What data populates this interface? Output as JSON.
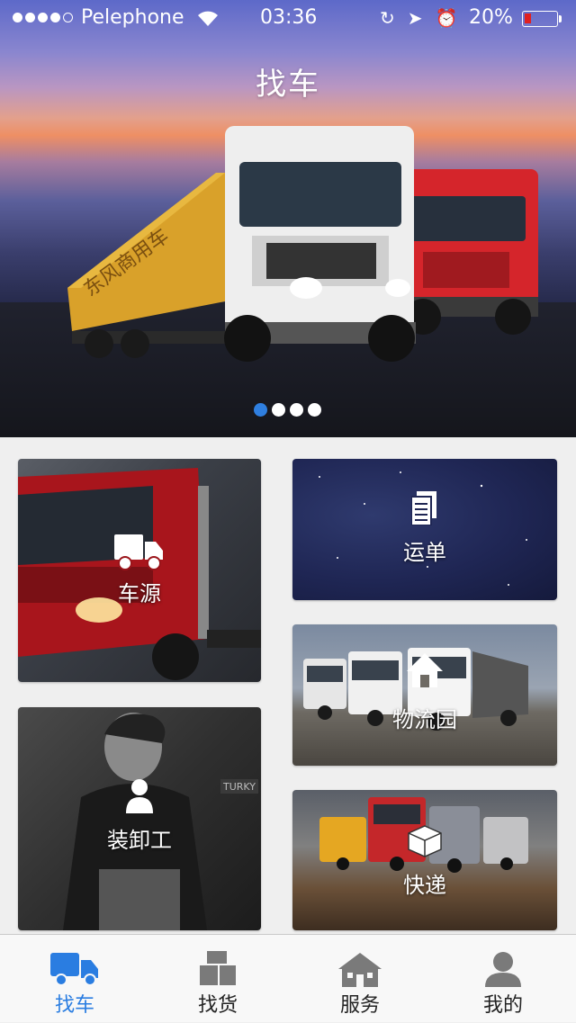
{
  "status_bar": {
    "carrier": "Pelephone",
    "time": "03:36",
    "battery_percent": "20%",
    "battery_level": 0.2,
    "signal_bars_filled": 4,
    "signal_bars_total": 5
  },
  "hero": {
    "title": "找车",
    "truck_text": "东风商用车",
    "pages_total": 4,
    "active_page": 1
  },
  "tiles": {
    "vehicle_source": "车源",
    "waybill": "运单",
    "logistics_park": "物流园",
    "loader": "装卸工",
    "express": "快递",
    "sign_text": "TURKY"
  },
  "tabbar": {
    "items": [
      {
        "label": "找车",
        "icon": "truck-icon",
        "active": true
      },
      {
        "label": "找货",
        "icon": "boxes-icon",
        "active": false
      },
      {
        "label": "服务",
        "icon": "building-icon",
        "active": false
      },
      {
        "label": "我的",
        "icon": "person-icon",
        "active": false
      }
    ]
  },
  "colors": {
    "accent": "#2a7de1",
    "battery_low": "#e02020",
    "tabbar_bg": "#f8f8f8",
    "page_bg": "#efefef"
  }
}
